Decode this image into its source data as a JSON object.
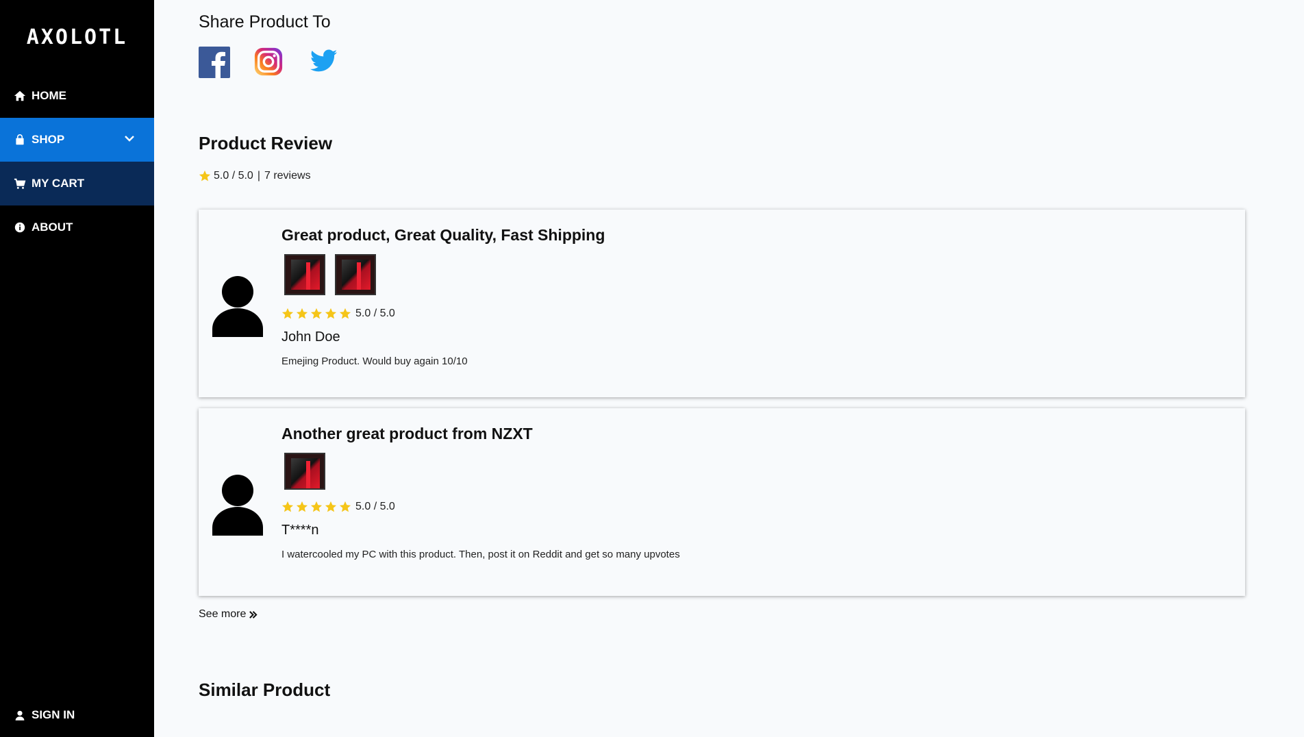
{
  "app": {
    "logo": "AXOLOTL"
  },
  "sidebar": {
    "items": [
      {
        "label": "HOME",
        "icon": "home-icon"
      },
      {
        "label": "SHOP",
        "icon": "shopping-bag-icon"
      },
      {
        "label": "MY CART",
        "icon": "cart-icon"
      },
      {
        "label": "ABOUT",
        "icon": "info-icon"
      }
    ],
    "signin": {
      "label": "SIGN IN",
      "icon": "user-icon"
    }
  },
  "share": {
    "heading": "Share Product To",
    "networks": [
      "facebook-icon",
      "instagram-icon",
      "twitter-icon"
    ]
  },
  "review_section": {
    "heading": "Product Review",
    "summary_rating": "5.0 / 5.0",
    "summary_separator": "|",
    "summary_count": "7 reviews",
    "reviews": [
      {
        "title": "Great product, Great Quality, Fast Shipping",
        "rating": "5.0 / 5.0",
        "stars": 5,
        "author": "John Doe",
        "text": "Emejing Product. Would buy again 10/10"
      },
      {
        "title": "Another great product from NZXT",
        "rating": "5.0 / 5.0",
        "stars": 5,
        "author": "T****n",
        "text": "I watercooled my PC with this product. Then, post it on Reddit and get so many upvotes"
      }
    ],
    "see_more": "See more"
  },
  "similar": {
    "heading": "Similar Product"
  },
  "colors": {
    "sidebar_bg": "#000000",
    "active_nav": "#0a73d9",
    "cart_nav": "#0a2a57",
    "star": "#f5c518",
    "page_bg": "#f8fafc"
  }
}
